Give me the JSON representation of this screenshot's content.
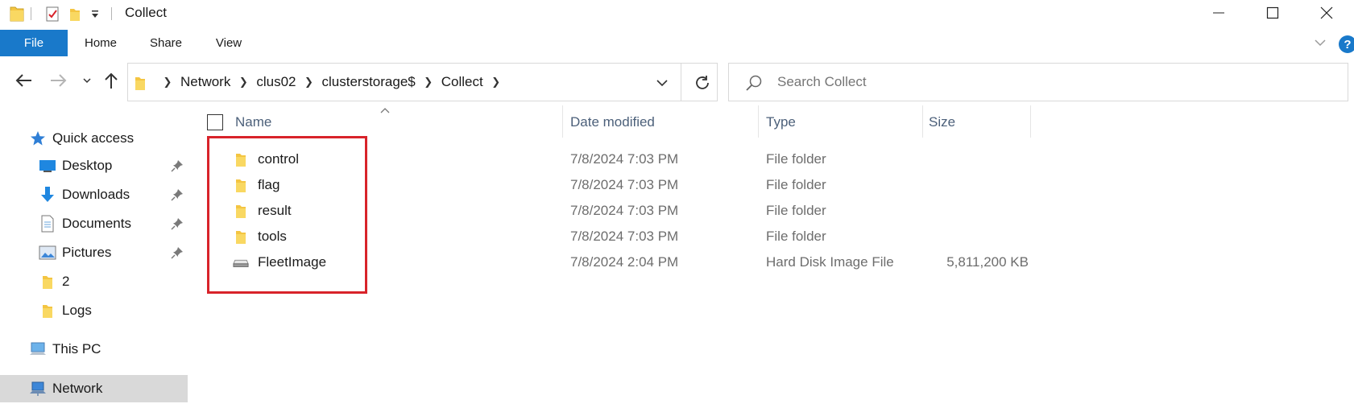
{
  "window": {
    "title": "Collect",
    "controls": {
      "minimize": "minimize-icon",
      "maximize": "maximize-icon",
      "close": "close-icon"
    }
  },
  "ribbon": {
    "tabs": [
      {
        "label": "File",
        "active": true
      },
      {
        "label": "Home"
      },
      {
        "label": "Share"
      },
      {
        "label": "View"
      }
    ],
    "help": "?"
  },
  "address": {
    "breadcrumbs": [
      "Network",
      "clus02",
      "clusterstorage$",
      "Collect"
    ]
  },
  "search": {
    "placeholder": "Search Collect"
  },
  "nav_pane": {
    "quick_access": "Quick access",
    "items": [
      {
        "label": "Desktop",
        "icon": "desktop-icon",
        "pinned": true
      },
      {
        "label": "Downloads",
        "icon": "download-arrow-icon",
        "pinned": true
      },
      {
        "label": "Documents",
        "icon": "documents-icon",
        "pinned": true
      },
      {
        "label": "Pictures",
        "icon": "pictures-icon",
        "pinned": true
      },
      {
        "label": "2",
        "icon": "folder-icon",
        "pinned": false
      },
      {
        "label": "Logs",
        "icon": "folder-icon",
        "pinned": false
      }
    ],
    "this_pc": "This PC",
    "network": "Network"
  },
  "columns": {
    "name": "Name",
    "date": "Date modified",
    "type": "Type",
    "size": "Size"
  },
  "files": [
    {
      "name": "control",
      "date": "7/8/2024 7:03 PM",
      "type": "File folder",
      "size": "",
      "icon": "folder-icon"
    },
    {
      "name": "flag",
      "date": "7/8/2024 7:03 PM",
      "type": "File folder",
      "size": "",
      "icon": "folder-icon"
    },
    {
      "name": "result",
      "date": "7/8/2024 7:03 PM",
      "type": "File folder",
      "size": "",
      "icon": "folder-icon"
    },
    {
      "name": "tools",
      "date": "7/8/2024 7:03 PM",
      "type": "File folder",
      "size": "",
      "icon": "folder-icon"
    },
    {
      "name": "FleetImage",
      "date": "7/8/2024 2:04 PM",
      "type": "Hard Disk Image File",
      "size": "5,811,200 KB",
      "icon": "disk-image-icon"
    }
  ],
  "colors": {
    "accent": "#1979ca",
    "highlight": "#d8232a",
    "folder": "#f4c542"
  }
}
